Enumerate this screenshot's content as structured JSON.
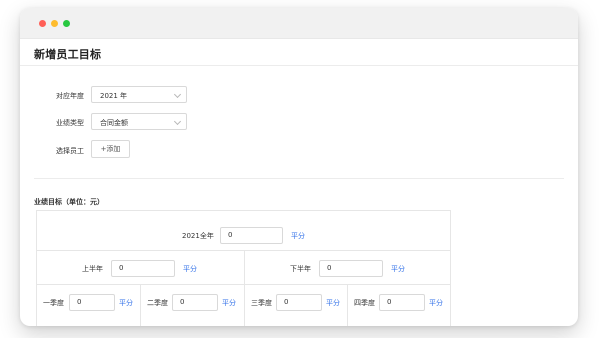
{
  "window": {
    "title": "新增员工目标"
  },
  "form": {
    "fiscal_year": {
      "label": "对应年度",
      "value": "2021 年"
    },
    "performance_type": {
      "label": "业绩类型",
      "value": "合同金额"
    },
    "employee": {
      "label": "选择员工",
      "button_label": "+添加"
    }
  },
  "targets": {
    "title": "业绩目标（单位：元）",
    "full_year": {
      "label": "2021全年",
      "value": "0",
      "split_label": "平分"
    },
    "halves": [
      {
        "label": "上半年",
        "value": "0",
        "split_label": "平分"
      },
      {
        "label": "下半年",
        "value": "0",
        "split_label": "平分"
      }
    ],
    "quarters": [
      {
        "label": "一季度",
        "value": "0",
        "split_label": "平分"
      },
      {
        "label": "二季度",
        "value": "0",
        "split_label": "平分"
      },
      {
        "label": "三季度",
        "value": "0",
        "split_label": "平分"
      },
      {
        "label": "四季度",
        "value": "0",
        "split_label": "平分"
      }
    ]
  }
}
